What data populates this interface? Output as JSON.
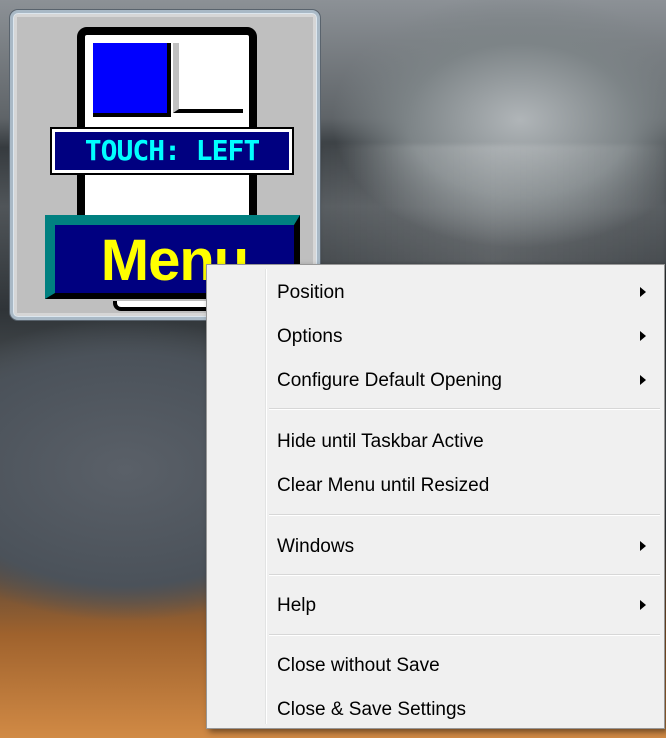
{
  "widget": {
    "touch_label": "TOUCH: LEFT",
    "menu_button_label": "Menu",
    "colors": {
      "body": "#ffffff",
      "blue_block": "#0000ff",
      "label_bg": "#000080",
      "label_text": "#00ffff",
      "button_bg": "#000080",
      "button_text": "#ffff00"
    }
  },
  "context_menu": {
    "items": [
      {
        "label": "Position",
        "has_submenu": true
      },
      {
        "label": "Options",
        "has_submenu": true
      },
      {
        "label": "Configure Default Opening",
        "has_submenu": true
      },
      {
        "label": "Hide until Taskbar Active",
        "has_submenu": false
      },
      {
        "label": "Clear Menu until Resized",
        "has_submenu": false
      },
      {
        "label": "Windows",
        "has_submenu": true
      },
      {
        "label": "Help",
        "has_submenu": true
      },
      {
        "label": "Close without Save",
        "has_submenu": false
      },
      {
        "label": "Close & Save Settings",
        "has_submenu": false
      }
    ],
    "icons": {
      "submenu": "chevron-right-icon"
    }
  }
}
